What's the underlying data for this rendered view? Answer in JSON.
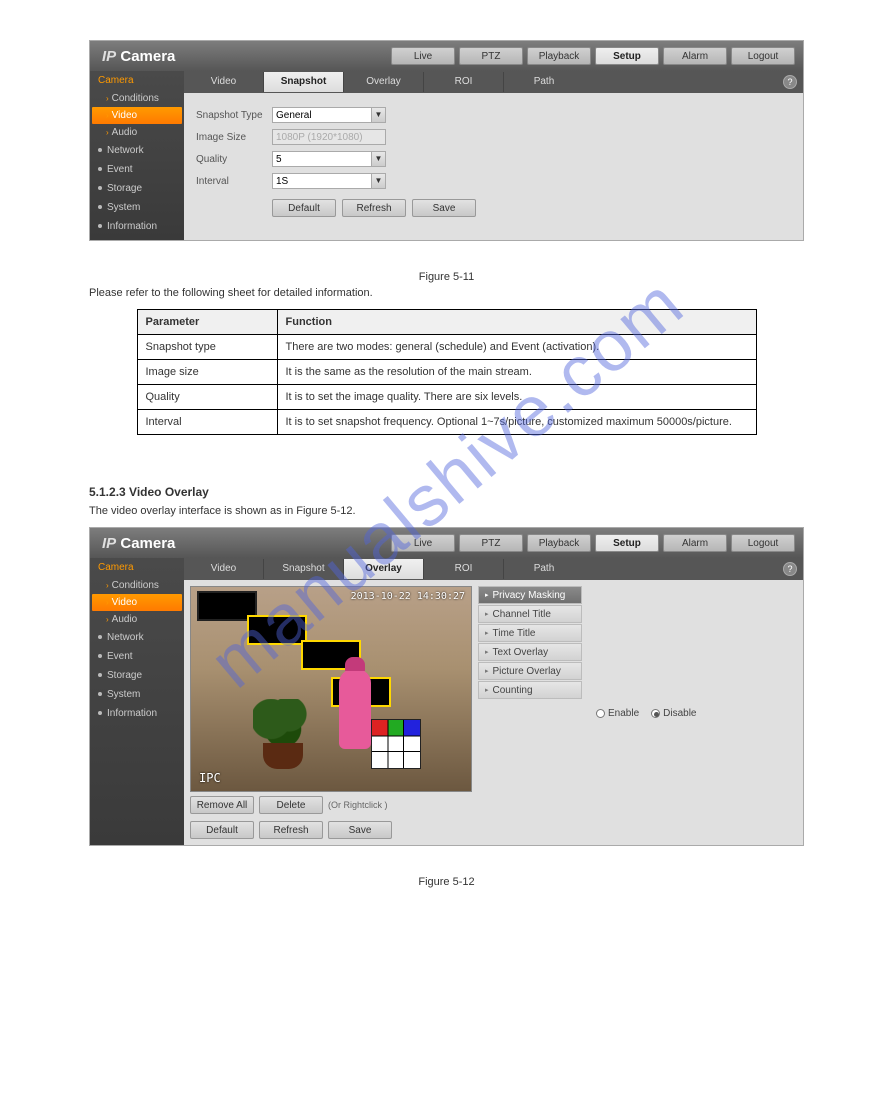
{
  "watermark": "manualshive.com",
  "logo_ip": "IP",
  "logo_camera": "Camera",
  "topnav": [
    "Live",
    "PTZ",
    "Playback",
    "Setup",
    "Alarm",
    "Logout"
  ],
  "topnav_active": "Setup",
  "sidebar": {
    "camera_group": "Camera",
    "items_sub": [
      "Conditions",
      "Video",
      "Audio"
    ],
    "items_sub_active": "Video",
    "groups": [
      "Network",
      "Event",
      "Storage",
      "System",
      "Information"
    ]
  },
  "tabs_snapshot": [
    "Video",
    "Snapshot",
    "Overlay",
    "ROI",
    "Path"
  ],
  "tabs_snapshot_active": "Snapshot",
  "snapshot_form": {
    "snapshot_type_label": "Snapshot Type",
    "snapshot_type_value": "General",
    "image_size_label": "Image Size",
    "image_size_value": "1080P (1920*1080)",
    "quality_label": "Quality",
    "quality_value": "5",
    "interval_label": "Interval",
    "interval_value": "1S"
  },
  "action_buttons": {
    "default": "Default",
    "refresh": "Refresh",
    "save": "Save"
  },
  "figure_caption_1": "Figure 5-11",
  "table_intro": "Please refer to the following sheet for detailed information.",
  "table_header": [
    "Parameter",
    "Function"
  ],
  "table_rows": [
    [
      "Snapshot type",
      "There are two modes: general (schedule) and Event (activation)."
    ],
    [
      "Image size",
      "It is the same as the resolution of the main stream."
    ],
    [
      "Quality",
      "It is to set the image quality. There are six levels."
    ],
    [
      "Interval",
      "It is to set snapshot frequency. Optional 1~7s/picture, customized maximum 50000s/picture."
    ]
  ],
  "section_heading_overlay": "5.1.2.3 Video Overlay",
  "overlay_intro": "The video overlay interface is shown as in Figure 5-12.",
  "tabs_overlay_active": "Overlay",
  "overlay_options": [
    "Privacy Masking",
    "Channel Title",
    "Time Title",
    "Text Overlay",
    "Picture Overlay",
    "Counting"
  ],
  "overlay_option_selected": "Privacy Masking",
  "radio": {
    "enable": "Enable",
    "disable": "Disable",
    "selected": "Disable"
  },
  "preview": {
    "timestamp": "2013-10-22 14:30:27",
    "label": "IPC"
  },
  "overlay_buttons": {
    "remove_all": "Remove All",
    "delete": "Delete",
    "hint": "(Or Rightclick )"
  },
  "figure_caption_2": "Figure 5-12"
}
